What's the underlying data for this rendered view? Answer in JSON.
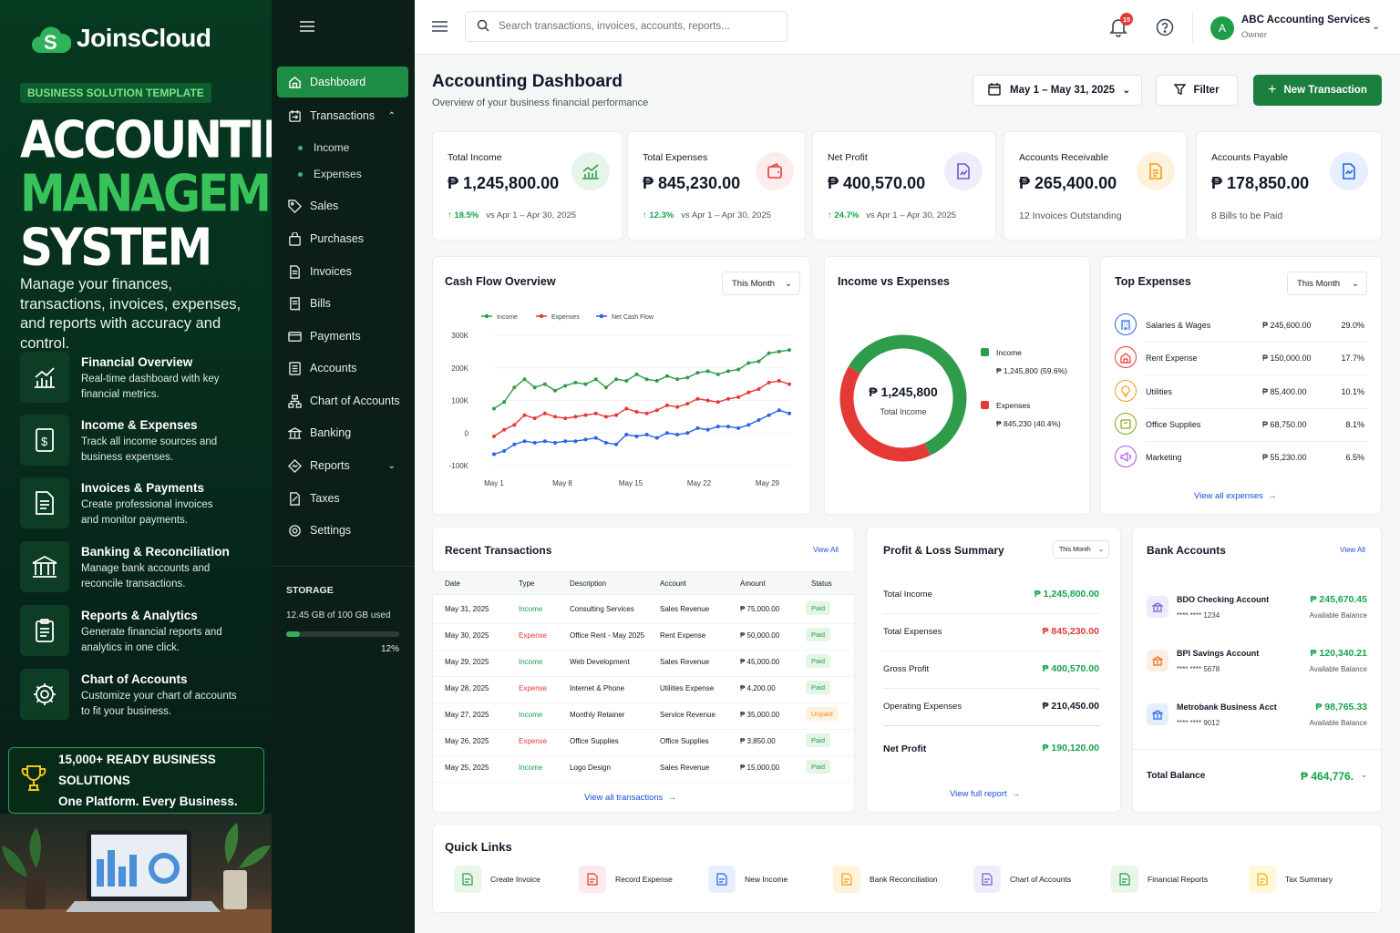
{
  "promo": {
    "logo": "JoinsCloud",
    "tag": "BUSINESS SOLUTION TEMPLATE",
    "headline": [
      "ACCOUNTING",
      "MANAGEMENT",
      "SYSTEM"
    ],
    "description": "Manage your finances, transactions, invoices, expenses, and reports with accuracy and control.",
    "features": [
      {
        "title": "Financial Overview",
        "sub": [
          "Real-time dashboard with key",
          "financial metrics."
        ]
      },
      {
        "title": "Income & Expenses",
        "sub": [
          "Track all income sources and",
          "business expenses."
        ]
      },
      {
        "title": "Invoices & Payments",
        "sub": [
          "Create professional invoices",
          "and monitor payments."
        ]
      },
      {
        "title": "Banking & Reconciliation",
        "sub": [
          "Manage bank accounts and",
          "reconcile transactions."
        ]
      },
      {
        "title": "Reports & Analytics",
        "sub": [
          "Generate financial reports and",
          "analytics in one click."
        ]
      },
      {
        "title": "Chart of Accounts",
        "sub": [
          "Customize your chart of accounts",
          "to fit your business."
        ]
      }
    ],
    "banner": [
      "15,000+ READY BUSINESS SOLUTIONS",
      "One Platform. Every Business."
    ]
  },
  "sidebar": {
    "items": [
      "Dashboard",
      "Transactions",
      "Sales",
      "Purchases",
      "Invoices",
      "Bills",
      "Payments",
      "Accounts",
      "Chart of Accounts",
      "Banking",
      "Reports",
      "Taxes",
      "Settings"
    ],
    "sub_items": [
      "Income",
      "Expenses"
    ],
    "storage": {
      "label": "STORAGE",
      "used": "12.45 GB of 100 GB used",
      "percent_text": "12%",
      "fraction": 0.12
    }
  },
  "topbar": {
    "search_placeholder": "Search transactions, invoices, accounts, reports...",
    "notifications": "15",
    "company": "ABC Accounting Services",
    "role": "Owner",
    "avatar": "A"
  },
  "header": {
    "title": "Accounting Dashboard",
    "subtitle": "Overview of your business financial performance",
    "date_range": "May 1 – May 31, 2025",
    "filter": "Filter",
    "new_transaction": "New Transaction"
  },
  "kpis": [
    {
      "label": "Total Income",
      "value": "₱ 1,245,800.00",
      "change": "18.5%",
      "compare": "vs Apr 1 – Apr 30, 2025",
      "color": "#16a34a"
    },
    {
      "label": "Total Expenses",
      "value": "₱ 845,230.00",
      "change": "12.3%",
      "compare": "vs Apr 1 – Apr 30, 2025",
      "color": "#e53935"
    },
    {
      "label": "Net Profit",
      "value": "₱ 400,570.00",
      "change": "24.7%",
      "compare": "vs Apr 1 – Apr 30, 2025",
      "color": "#6d5bd0"
    },
    {
      "label": "Accounts Receivable",
      "value": "₱ 265,400.00",
      "note": "12 Invoices Outstanding",
      "color": "#f59e0b"
    },
    {
      "label": "Accounts Payable",
      "value": "₱ 178,850.00",
      "note": "8 Bills to be Paid",
      "color": "#2563eb"
    }
  ],
  "cashflow": {
    "title": "Cash Flow Overview",
    "period": "This Month",
    "y_ticks": [
      "300K",
      "200K",
      "100K",
      "0",
      "-100K"
    ],
    "x_ticks": [
      "May 1",
      "May 8",
      "May 15",
      "May 22",
      "May 29"
    ]
  },
  "chart_data": {
    "type": "line",
    "title": "Cash Flow Overview",
    "ylim": [
      -100000,
      300000
    ],
    "categories": [
      "May 1",
      "May 8",
      "May 15",
      "May 22",
      "May 29"
    ],
    "series": [
      {
        "name": "Income",
        "color": "#2e9c4b",
        "values": [
          75000,
          95000,
          140000,
          165000,
          140000,
          150000,
          130000,
          145000,
          155000,
          150000,
          165000,
          140000,
          165000,
          160000,
          180000,
          165000,
          160000,
          175000,
          165000,
          170000,
          185000,
          190000,
          180000,
          190000,
          195000,
          215000,
          220000,
          245000,
          250000,
          255000
        ]
      },
      {
        "name": "Expenses",
        "color": "#e53935",
        "values": [
          -10000,
          10000,
          25000,
          55000,
          45000,
          60000,
          50000,
          45000,
          50000,
          55000,
          60000,
          50000,
          55000,
          75000,
          65000,
          60000,
          70000,
          85000,
          80000,
          90000,
          105000,
          100000,
          95000,
          105000,
          110000,
          125000,
          135000,
          155000,
          160000,
          150000
        ]
      },
      {
        "name": "Net Cash Flow",
        "color": "#2563eb",
        "values": [
          -65000,
          -55000,
          -35000,
          -25000,
          -30000,
          -25000,
          -30000,
          -25000,
          -25000,
          -20000,
          -15000,
          -30000,
          -35000,
          -5000,
          -10000,
          -5000,
          -15000,
          0,
          -5000,
          0,
          15000,
          10000,
          20000,
          20000,
          15000,
          25000,
          40000,
          55000,
          70000,
          60000
        ]
      }
    ]
  },
  "income_vs_expenses": {
    "title": "Income vs Expenses",
    "center_value": "₱ 1,245,800",
    "center_label": "Total Income",
    "legend": [
      {
        "label": "Income",
        "value": "₱ 1,245,800 (59.6%)",
        "color": "#2e9c4b",
        "fraction": 0.596
      },
      {
        "label": "Expenses",
        "value": "₱ 845,230 (40.4%)",
        "color": "#e53935",
        "fraction": 0.404
      }
    ]
  },
  "top_expenses": {
    "title": "Top Expenses",
    "period": "This Month",
    "rows": [
      {
        "name": "Salaries & Wages",
        "amount": "₱ 245,600.00",
        "pct": "29.0%",
        "color": "#2563eb",
        "icon": "building-icon"
      },
      {
        "name": "Rent Expense",
        "amount": "₱ 150,000.00",
        "pct": "17.7%",
        "color": "#e53935",
        "icon": "house-icon"
      },
      {
        "name": "Utilities",
        "amount": "₱ 85,400.00",
        "pct": "10.1%",
        "color": "#f59e0b",
        "icon": "bulb-icon"
      },
      {
        "name": "Office Supplies",
        "amount": "₱ 68,750.00",
        "pct": "8.1%",
        "color": "#84a316",
        "icon": "box-icon"
      },
      {
        "name": "Marketing",
        "amount": "₱ 55,230.00",
        "pct": "6.5%",
        "color": "#a855f7",
        "icon": "megaphone-icon"
      }
    ],
    "link": "View all expenses"
  },
  "recent": {
    "title": "Recent Transactions",
    "view_all": "View All",
    "columns": [
      "Date",
      "Type",
      "Description",
      "Account",
      "Amount",
      "Status"
    ],
    "rows": [
      [
        "May 31, 2025",
        "Income",
        "Consulting Services",
        "Sales Revenue",
        "₱ 75,000.00",
        "Paid"
      ],
      [
        "May 30, 2025",
        "Expense",
        "Office Rent - May 2025",
        "Rent Expense",
        "₱ 50,000.00",
        "Paid"
      ],
      [
        "May 29, 2025",
        "Income",
        "Web Development",
        "Sales Revenue",
        "₱ 45,000.00",
        "Paid"
      ],
      [
        "May 28, 2025",
        "Expense",
        "Internet & Phone",
        "Utilities Expense",
        "₱ 4,200.00",
        "Paid"
      ],
      [
        "May 27, 2025",
        "Income",
        "Monthly Retainer",
        "Service Revenue",
        "₱ 35,000.00",
        "Unpaid"
      ],
      [
        "May 26, 2025",
        "Expense",
        "Office Supplies",
        "Office Supplies",
        "₱ 3,850.00",
        "Paid"
      ],
      [
        "May 25, 2025",
        "Income",
        "Logo Design",
        "Sales Revenue",
        "₱ 15,000.00",
        "Paid"
      ]
    ],
    "link": "View all transactions"
  },
  "pnl": {
    "title": "Profit & Loss Summary",
    "period": "This Month",
    "rows": [
      {
        "label": "Total Income",
        "value": "₱ 1,245,800.00",
        "color": "#16a34a"
      },
      {
        "label": "Total Expenses",
        "value": "₱ 845,230.00",
        "color": "#e53935"
      },
      {
        "label": "Gross Profit",
        "value": "₱ 400,570.00",
        "color": "#16a34a"
      },
      {
        "label": "Operating Expenses",
        "value": "₱ 210,450.00",
        "color": "#111827"
      },
      {
        "label": "Net Profit",
        "value": "₱ 190,120.00",
        "color": "#16a34a"
      }
    ],
    "link": "View full report"
  },
  "banks": {
    "title": "Bank Accounts",
    "view_all": "View All",
    "rows": [
      {
        "name": "BDO Checking Account",
        "num": "**** **** 1234",
        "amount": "₱ 245,670.45",
        "note": "Available Balance",
        "color": "#6d5bd0"
      },
      {
        "name": "BPI Savings Account",
        "num": "**** **** 5678",
        "amount": "₱ 120,340.21",
        "note": "Available Balance",
        "color": "#ef6c1c"
      },
      {
        "name": "Metrobank Business Acct",
        "num": "**** **** 9012",
        "amount": "₱ 98,765.33",
        "note": "Available Balance",
        "color": "#2563eb"
      }
    ],
    "total_label": "Total Balance",
    "total_value": "₱ 464,776."
  },
  "quick_links": {
    "title": "Quick Links",
    "items": [
      {
        "label": "Create Invoice",
        "color": "#2e9c4b",
        "bg": "#e8f6ea"
      },
      {
        "label": "Record Expense",
        "color": "#e53935",
        "bg": "#fdeaea"
      },
      {
        "label": "New Income",
        "color": "#2563eb",
        "bg": "#e7efff"
      },
      {
        "label": "Bank Reconciliation",
        "color": "#f59e0b",
        "bg": "#fff3dc"
      },
      {
        "label": "Chart of Accounts",
        "color": "#6d5bd0",
        "bg": "#efecfb"
      },
      {
        "label": "Financial Reports",
        "color": "#16a34a",
        "bg": "#e8f6ea"
      },
      {
        "label": "Tax Summary",
        "color": "#eab308",
        "bg": "#fff8d8"
      }
    ]
  }
}
